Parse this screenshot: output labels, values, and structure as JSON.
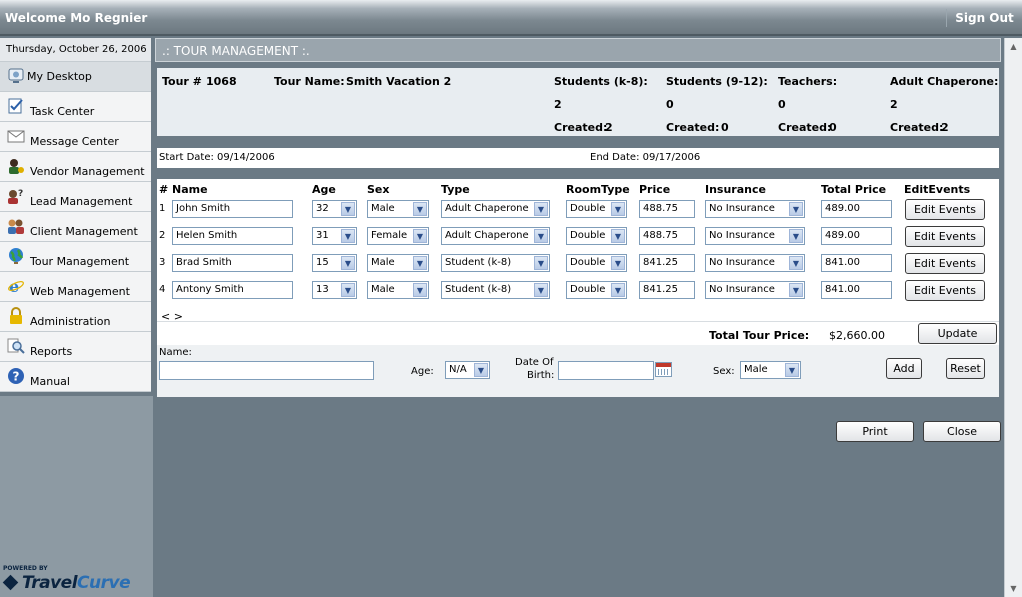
{
  "header": {
    "welcome": "Welcome Mo Regnier",
    "signout": "Sign Out"
  },
  "sidebar": {
    "date": "Thursday, October 26, 2006",
    "items": [
      {
        "label": "My Desktop",
        "icon": "desktop-icon"
      },
      {
        "label": "Task Center",
        "icon": "task-icon"
      },
      {
        "label": "Message Center",
        "icon": "envelope-icon"
      },
      {
        "label": "Vendor Management",
        "icon": "vendor-icon"
      },
      {
        "label": "Lead Management",
        "icon": "lead-icon"
      },
      {
        "label": "Client Management",
        "icon": "clients-icon"
      },
      {
        "label": "Tour Management",
        "icon": "globe-icon"
      },
      {
        "label": "Web Management",
        "icon": "ie-icon"
      },
      {
        "label": "Administration",
        "icon": "lock-icon"
      },
      {
        "label": "Reports",
        "icon": "magnifier-icon"
      },
      {
        "label": "Manual",
        "icon": "help-icon"
      }
    ],
    "powered_by": "POWERED BY",
    "brand_a": "Travel",
    "brand_b": "Curve"
  },
  "page": {
    "title": ".: TOUR MANAGEMENT :."
  },
  "tour": {
    "number_label": "Tour #",
    "number": "1068",
    "name_label": "Tour Name:",
    "name": "Smith Vacation 2",
    "groups": [
      {
        "label": "Students (k-8):",
        "count": "2",
        "created_label": "Created:",
        "created": "2"
      },
      {
        "label": "Students (9-12):",
        "count": "0",
        "created_label": "Created:",
        "created": "0"
      },
      {
        "label": "Teachers:",
        "count": "0",
        "created_label": "Created:",
        "created": "0"
      },
      {
        "label": "Adult Chaperone:",
        "count": "2",
        "created_label": "Created:",
        "created": "2"
      }
    ]
  },
  "dates": {
    "start": "Start Date: 09/14/2006",
    "end": "End Date: 09/17/2006"
  },
  "table": {
    "headers": [
      "#",
      "Name",
      "Age",
      "Sex",
      "Type",
      "RoomType",
      "Price",
      "Insurance",
      "Total Price",
      "EditEvents"
    ],
    "rows": [
      {
        "num": "1",
        "name": "John Smith",
        "age": "32",
        "sex": "Male",
        "type": "Adult Chaperone",
        "room": "Double",
        "price": "488.75",
        "insurance": "No Insurance",
        "total": "489.00",
        "action": "Edit Events"
      },
      {
        "num": "2",
        "name": "Helen Smith",
        "age": "31",
        "sex": "Female",
        "type": "Adult Chaperone",
        "room": "Double",
        "price": "488.75",
        "insurance": "No Insurance",
        "total": "489.00",
        "action": "Edit Events"
      },
      {
        "num": "3",
        "name": "Brad Smith",
        "age": "15",
        "sex": "Male",
        "type": "Student (k-8)",
        "room": "Double",
        "price": "841.25",
        "insurance": "No Insurance",
        "total": "841.00",
        "action": "Edit Events"
      },
      {
        "num": "4",
        "name": "Antony Smith",
        "age": "13",
        "sex": "Male",
        "type": "Student (k-8)",
        "room": "Double",
        "price": "841.25",
        "insurance": "No Insurance",
        "total": "841.00",
        "action": "Edit Events"
      }
    ],
    "nav": "< >",
    "total_label": "Total Tour Price:",
    "total_value": "$2,660.00",
    "update": "Update"
  },
  "add_form": {
    "name_label": "Name:",
    "name_value": "",
    "age_label": "Age:",
    "age_value": "N/A",
    "dob_label_1": "Date Of",
    "dob_label_2": "Birth:",
    "dob_value": "",
    "sex_label": "Sex:",
    "sex_value": "Male",
    "add": "Add",
    "reset": "Reset"
  },
  "footer": {
    "print": "Print",
    "close": "Close"
  }
}
